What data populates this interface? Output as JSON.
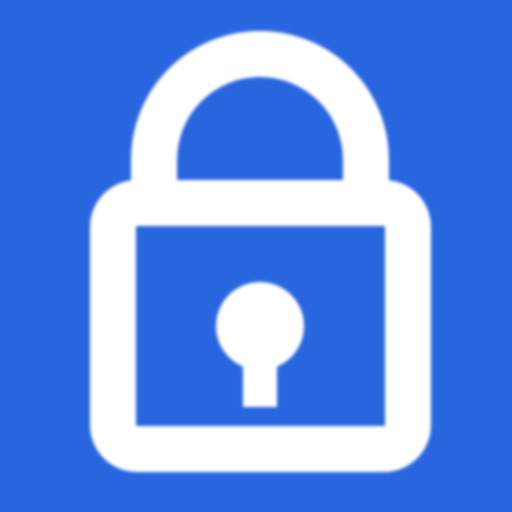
{
  "icon": {
    "name": "lock-icon",
    "background_color": "#2866E0",
    "glyph_color": "#FFFFFF"
  }
}
